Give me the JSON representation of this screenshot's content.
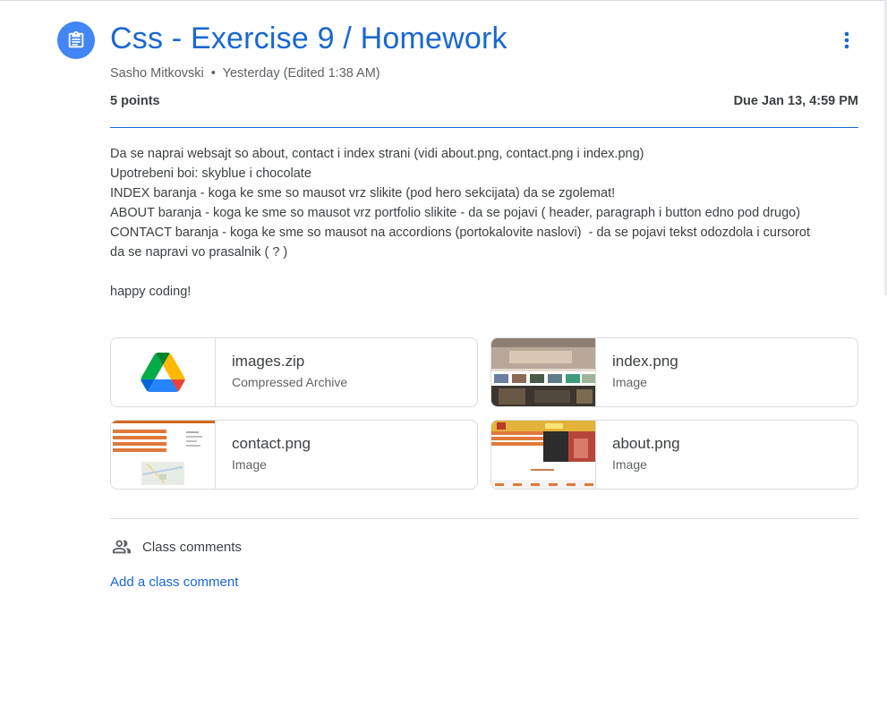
{
  "assignment": {
    "title": "Css - Exercise 9 / Homework",
    "author": "Sasho Mitkovski",
    "separator": "•",
    "posted": "Yesterday (Edited 1:38 AM)",
    "points": "5 points",
    "due": "Due Jan 13, 4:59 PM"
  },
  "description": {
    "lines": [
      "Da se naprai websajt so about, contact i index strani (vidi about.png, contact.png i index.png)",
      "Upotrebeni boi: skyblue i chocolate",
      "INDEX baranja - koga ke sme so mausot vrz slikite (pod hero sekcijata) da se zgolemat!",
      "ABOUT baranja - koga ke sme so mausot vrz portfolio slikite - da se pojavi ( header, paragraph i button edno pod drugo)",
      "CONTACT baranja - koga ke sme so mausot na accordions (portokalovite naslovi)  - da se pojavi tekst odozdola i cursorot da se napravi vo prasalnik ( ? )",
      "",
      "happy coding!"
    ]
  },
  "attachments": [
    {
      "name": "images.zip",
      "type": "Compressed Archive",
      "thumb": "google-drive-icon"
    },
    {
      "name": "index.png",
      "type": "Image",
      "thumb": "index-preview"
    },
    {
      "name": "contact.png",
      "type": "Image",
      "thumb": "contact-preview"
    },
    {
      "name": "about.png",
      "type": "Image",
      "thumb": "about-preview"
    }
  ],
  "comments": {
    "label": "Class comments",
    "add_label": "Add a class comment"
  },
  "colors": {
    "accent": "#1967d2",
    "icon_bg": "#4285f4",
    "text": "#3c4043",
    "muted": "#5f6368",
    "border": "#dadce0"
  },
  "icons": {
    "assignment": "assignment-icon",
    "more": "more-vert-icon",
    "people": "people-icon"
  }
}
